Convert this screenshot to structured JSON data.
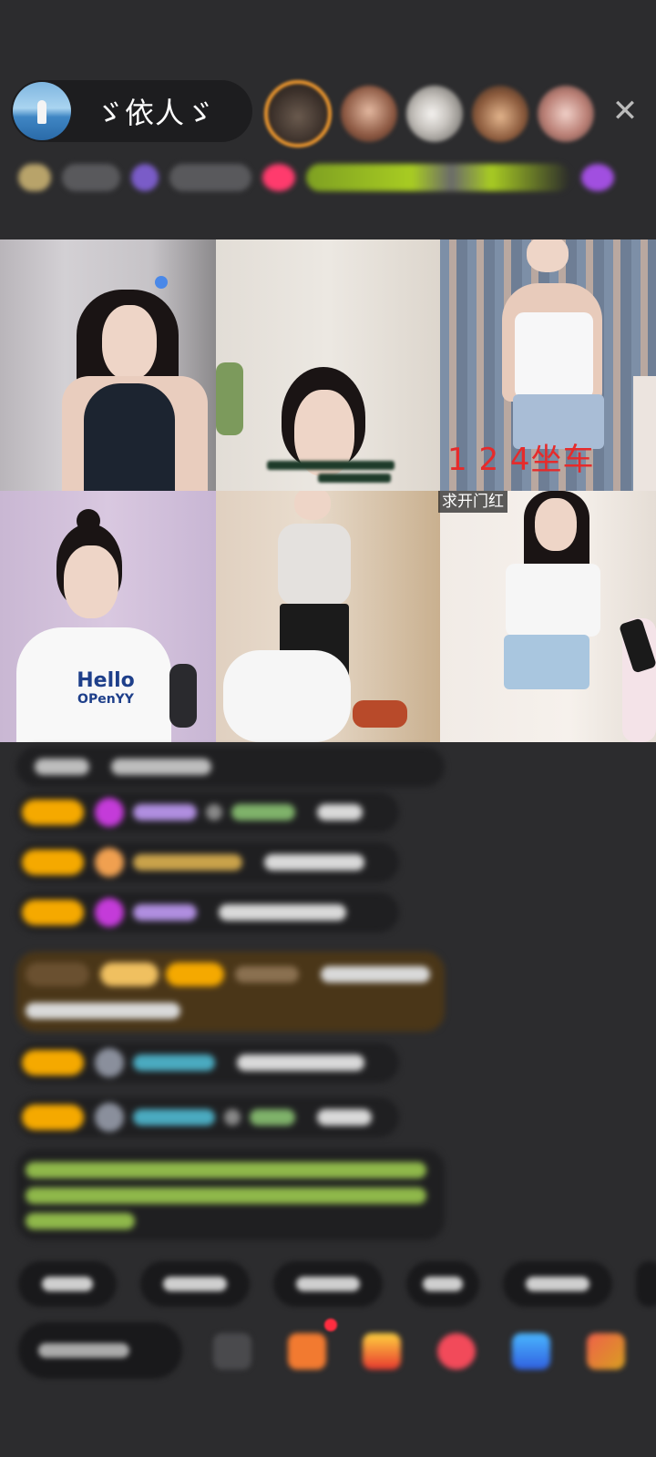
{
  "header": {
    "host_name": "ゞ依人ゞ",
    "close_icon": "close-icon",
    "viewer_count": 5
  },
  "video_grid": {
    "tiles": [
      {
        "id": "tile-1"
      },
      {
        "id": "tile-2"
      },
      {
        "id": "tile-3",
        "overlay_text": "1 2 4坐车"
      },
      {
        "id": "tile-4",
        "shirt_line1": "Hello",
        "shirt_line2": "OPenYY"
      },
      {
        "id": "tile-5"
      },
      {
        "id": "tile-6",
        "overlay_tag": "求开门红"
      }
    ]
  },
  "colors": {
    "background": "#2c2c2e",
    "level_badge": "#f5a900",
    "accent_orange": "#f29a2e",
    "overlay_red": "#e62b2b",
    "gift_panel": "#4a3618"
  }
}
